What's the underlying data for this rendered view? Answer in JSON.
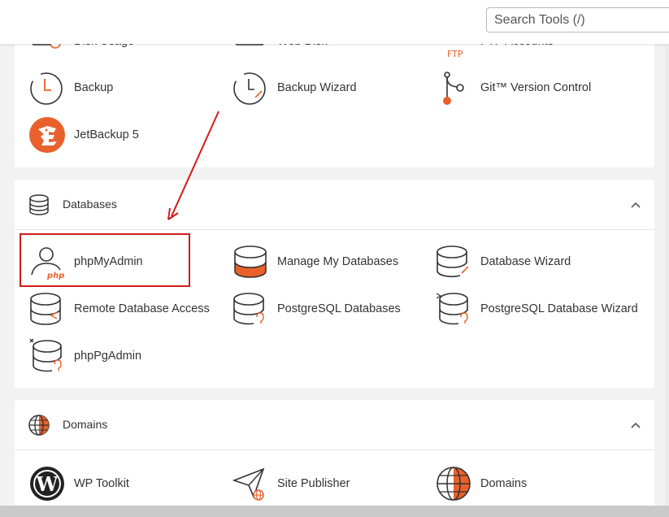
{
  "search": {
    "placeholder": "Search Tools (/)"
  },
  "files": {
    "partial_row": [
      {
        "label": "Disk Usage",
        "icon": "disk-usage-icon"
      },
      {
        "label": "Web Disk",
        "icon": "web-disk-icon"
      },
      {
        "label": "FTP Accounts",
        "icon": "ftp-accounts-icon"
      }
    ],
    "items": [
      {
        "label": "Backup",
        "icon": "backup-icon"
      },
      {
        "label": "Backup Wizard",
        "icon": "backup-wizard-icon"
      },
      {
        "label": "Git™ Version Control",
        "icon": "git-icon"
      },
      {
        "label": "JetBackup 5",
        "icon": "jetbackup-icon"
      }
    ]
  },
  "databases": {
    "title": "Databases",
    "items": [
      {
        "label": "phpMyAdmin",
        "icon": "phpmyadmin-icon"
      },
      {
        "label": "Manage My Databases",
        "icon": "manage-databases-icon"
      },
      {
        "label": "Database Wizard",
        "icon": "database-wizard-icon"
      },
      {
        "label": "Remote Database Access",
        "icon": "remote-database-icon"
      },
      {
        "label": "PostgreSQL Databases",
        "icon": "postgresql-databases-icon"
      },
      {
        "label": "PostgreSQL Database Wizard",
        "icon": "postgresql-wizard-icon"
      },
      {
        "label": "phpPgAdmin",
        "icon": "phppgadmin-icon"
      }
    ]
  },
  "domains": {
    "title": "Domains",
    "items": [
      {
        "label": "WP Toolkit",
        "icon": "wordpress-icon"
      },
      {
        "label": "Site Publisher",
        "icon": "site-publisher-icon"
      },
      {
        "label": "Domains",
        "icon": "globe-icon"
      }
    ]
  },
  "colors": {
    "accent": "#e8612c",
    "highlight": "#d21a1a",
    "text": "#333333"
  }
}
